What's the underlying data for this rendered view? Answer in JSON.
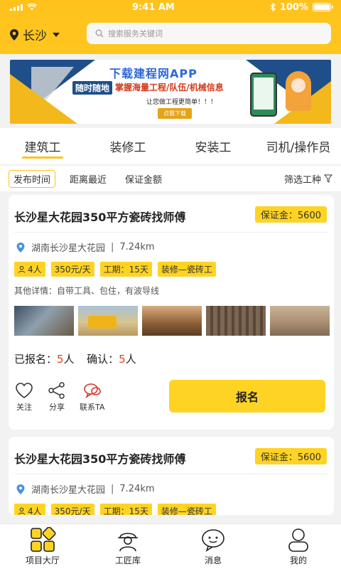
{
  "status": {
    "time": "9:41 AM",
    "battery": "100%"
  },
  "header": {
    "city": "长沙",
    "search_placeholder": "搜索服务关键词"
  },
  "banner": {
    "title": "下载建程网APP",
    "line_a": "随时随地",
    "line_b": "掌握海量工程/队伍/机械信息",
    "sub": "让您做工程更简单！！！",
    "button": "点我下载"
  },
  "tabs": [
    {
      "label": "建筑工",
      "active": true
    },
    {
      "label": "装修工",
      "active": false
    },
    {
      "label": "安装工",
      "active": false
    },
    {
      "label": "司机/操作员",
      "active": false
    }
  ],
  "filters": {
    "chips": [
      "发布时间",
      "距离最近",
      "保证金额"
    ],
    "right_label": "筛选工种"
  },
  "cards": [
    {
      "title": "长沙星大花园350平方瓷砖找师傅",
      "deposit": "保证金：5600",
      "address": "湖南长沙星大花园",
      "distance": "7.24km",
      "tags": [
        "4人",
        "350元/天",
        "工期：15天",
        "装修—瓷砖工"
      ],
      "detail": "其他详情：自带工具、包住，有波导线",
      "signed_label": "已报名：",
      "signed_num": "5",
      "signed_unit": "人",
      "confirm_label": "确认：",
      "confirm_num": "5",
      "confirm_unit": "人",
      "actions": [
        "关注",
        "分享",
        "联系TA"
      ],
      "button": "报名"
    },
    {
      "title": "长沙星大花园350平方瓷砖找师傅",
      "deposit": "保证金：5600",
      "address": "湖南长沙星大花园",
      "distance": "7.24km",
      "tags": [
        "4人",
        "350元/天",
        "工期：15天",
        "装修—瓷砖工"
      ]
    }
  ],
  "bottom_nav": [
    "项目大厅",
    "工匠库",
    "消息",
    "我的"
  ],
  "colors": {
    "accent": "#ffc21c",
    "tag": "#ffd323",
    "highlight": "#e0431b"
  }
}
